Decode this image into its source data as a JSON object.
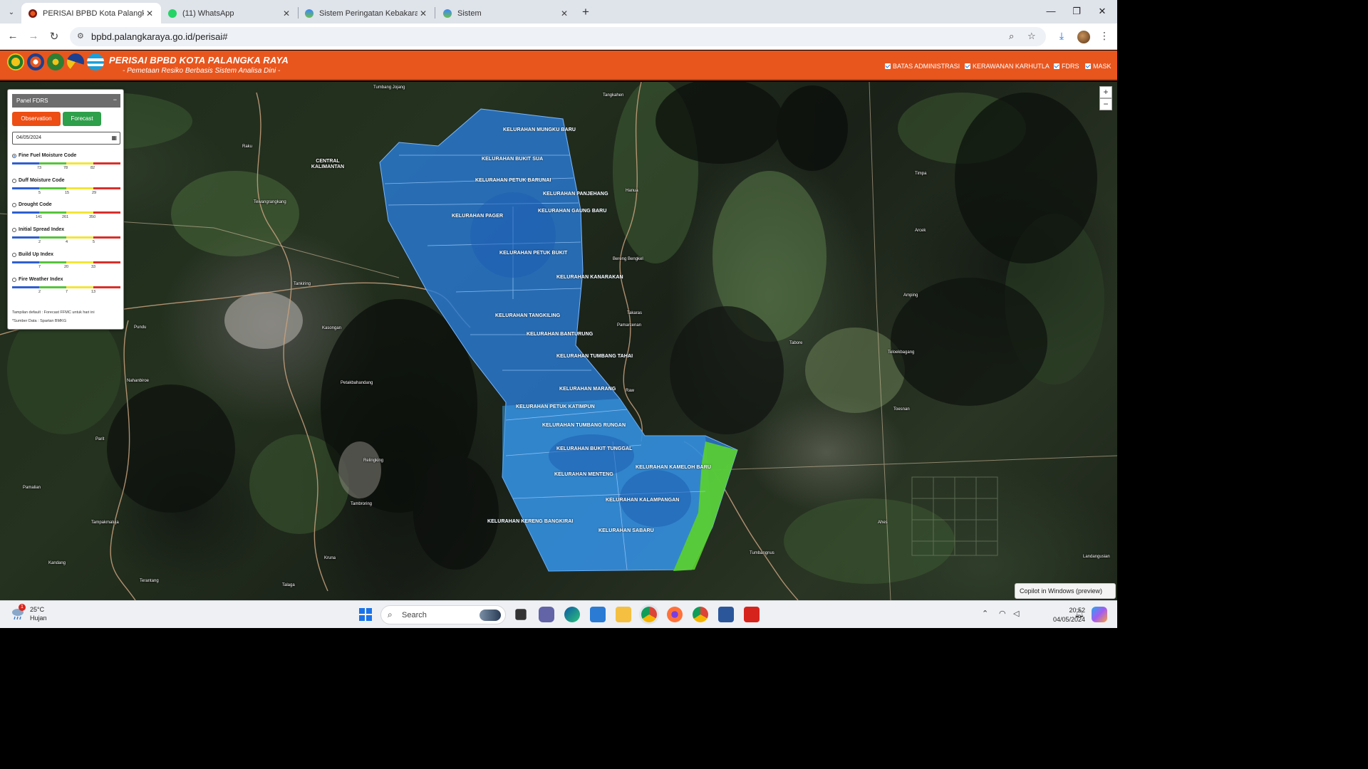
{
  "browser": {
    "tabs": [
      {
        "title": "PERISAI BPBD Kota Palangka Ra",
        "icon": "bpbd-favicon",
        "active": true
      },
      {
        "title": "(11) WhatsApp",
        "icon": "whatsapp-favicon",
        "active": false
      },
      {
        "title": "Sistem Peringatan Kebakaran H",
        "icon": "globe-favicon",
        "active": false
      },
      {
        "title": "Sistem",
        "icon": "globe-favicon",
        "active": false
      }
    ],
    "url": "bpbd.palangkaraya.go.id/perisai#"
  },
  "header": {
    "title": "PERISAI BPBD KOTA PALANGKA RAYA",
    "subtitle": "- Pemetaan Resiko Berbasis Sistem Analisa Dini -",
    "layers": [
      {
        "label": "BATAS ADMINISTRASI",
        "checked": true
      },
      {
        "label": "KERAWANAN KARHUTLA",
        "checked": true
      },
      {
        "label": "FDRS",
        "checked": true
      },
      {
        "label": "MASK",
        "checked": true
      }
    ],
    "accent_color": "#e8561e"
  },
  "panel": {
    "title": "Panel FDRS",
    "observation_label": "Observation",
    "forecast_label": "Forecast",
    "date_value": "04/05/2024",
    "indices": [
      {
        "label": "Fine Fuel Moisture Code",
        "selected": true,
        "ticks": [
          "73",
          "78",
          "82"
        ]
      },
      {
        "label": "Duff Moisture Code",
        "selected": false,
        "ticks": [
          "5",
          "15",
          "29"
        ]
      },
      {
        "label": "Drought Code",
        "selected": false,
        "ticks": [
          "141",
          "261",
          "350"
        ]
      },
      {
        "label": "Initial Spread Index",
        "selected": false,
        "ticks": [
          "2",
          "4",
          "5"
        ]
      },
      {
        "label": "Build Up Index",
        "selected": false,
        "ticks": [
          "7",
          "20",
          "33"
        ]
      },
      {
        "label": "Fire Weather Index",
        "selected": false,
        "ticks": [
          "2",
          "7",
          "13"
        ]
      }
    ],
    "scale_colors": [
      "#2f5fd0",
      "#57c43b",
      "#f2e53a",
      "#d9302a"
    ],
    "note_default": "Tampilan default : Forecast FFMC untuk hari ini",
    "note_source": "*Sumber Data : Spartan BMKG"
  },
  "map": {
    "kelurahan": [
      "KELURAHAN MUNGKU BARU",
      "KELURAHAN BUKIT SUA",
      "KELURAHAN PETUK BARUNAI",
      "KELURAHAN PANJEHANG",
      "KELURAHAN PAGER",
      "KELURAHAN GAUNG BARU",
      "KELURAHAN PETUK BUKIT",
      "KELURAHAN KANARAKAN",
      "KELURAHAN TANGKILING",
      "KELURAHAN BANTURUNG",
      "KELURAHAN TUMBANG TAHAI",
      "KELURAHAN MARANG",
      "KELURAHAN PETUK KATIMPUN",
      "KELURAHAN TUMBANG RUNGAN",
      "KELURAHAN BUKIT TUNGGAL",
      "KELURAHAN KAMELOH BARU",
      "KELURAHAN MENTENG",
      "KELURAHAN KALAMPANGAN",
      "KELURAHAN KERENG BANGKIRAI",
      "KELURAHAN SABARU"
    ],
    "places": [
      "Tumbang Jojang",
      "Tangkahen",
      "Raku",
      "CENTRAL KALIMANTAN",
      "Tewangrangkang",
      "Hanua",
      "Timpa",
      "Arcek",
      "Bereng Bengkel",
      "Takaras",
      "Tankiring",
      "Amping",
      "Pamarcenan",
      "Pundu",
      "Kasongan",
      "Tabore",
      "Teloekbagang",
      "Nahanbiroe",
      "Petakbahandang",
      "Raw",
      "Toesnan",
      "Parit",
      "Pamalian",
      "Relingking",
      "Tambroring",
      "Tampakmaluja",
      "Kandang",
      "Kruna",
      "Ahes",
      "Tumbangnus",
      "Terantang",
      "Talaga",
      "Landangusian"
    ],
    "zoom_in": "+",
    "zoom_out": "−"
  },
  "tooltip": {
    "copilot": "Copilot in Windows (preview)"
  },
  "taskbar": {
    "weather_temp": "25°C",
    "weather_desc": "Hujan",
    "weather_badge": "1",
    "search_placeholder": "Search",
    "time": "20:52",
    "date": "04/05/2024"
  }
}
